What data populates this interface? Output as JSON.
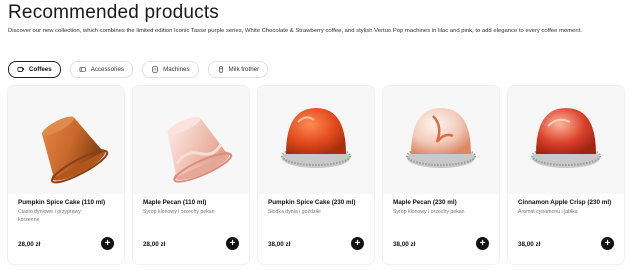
{
  "header": {
    "title": "Recommended products",
    "intro": "Discover our new collection, which combines the limited edition Iconic Tasse purple series, White Chocolate & Strawberry coffee, and stylish Vertuo Pop machines in lilac and pink, to add elegance to every coffee moment."
  },
  "tabs": [
    {
      "label": "Coffees",
      "icon": "coffee-icon",
      "active": true
    },
    {
      "label": "Accessories",
      "icon": "accessories-icon",
      "active": false
    },
    {
      "label": "Machines",
      "icon": "machine-icon",
      "active": false
    },
    {
      "label": "Milk frother",
      "icon": "milk-frother-icon",
      "active": false
    }
  ],
  "products": [
    {
      "name": "Pumpkin Spice Cake (110 ml)",
      "description": "Ciasto dyniowe i przyprawy korzenne",
      "price": "28,00 zł",
      "add_icon": "plus-icon",
      "capsule": "original",
      "color": "#c8682a"
    },
    {
      "name": "Maple Pecan (110 ml)",
      "description": "Syrop klonowy i orzechy pekan",
      "price": "28,00 zł",
      "add_icon": "plus-icon",
      "capsule": "original",
      "color": "#f0c6bc"
    },
    {
      "name": "Pumpkin Spice Cake (230 ml)",
      "description": "Słodka dynia i goździki",
      "price": "38,00 zł",
      "add_icon": "plus-icon",
      "capsule": "vertuo",
      "color": "#e24a1c"
    },
    {
      "name": "Maple Pecan (230 ml)",
      "description": "Syrop klonowy i orzechy pekan",
      "price": "38,00 zł",
      "add_icon": "plus-icon",
      "capsule": "vertuo",
      "color": "#f2c9b8"
    },
    {
      "name": "Cinnamon Apple Crisp (230 ml)",
      "description": "Aromat cynamonu i jabłka",
      "price": "38,00 zł",
      "add_icon": "plus-icon",
      "capsule": "vertuo",
      "color": "#d9402a"
    }
  ],
  "colors": {
    "accent": "#111111",
    "card_image_bg": "#f7f7f7"
  }
}
